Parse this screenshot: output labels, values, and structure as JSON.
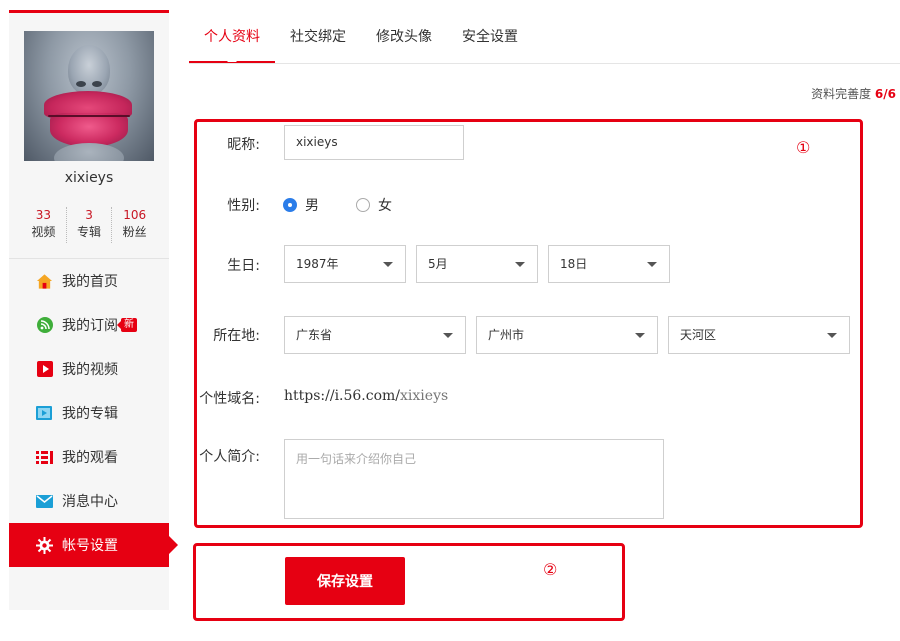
{
  "sidebar": {
    "username": "xixieys",
    "stats": [
      {
        "num": "33",
        "label": "视频"
      },
      {
        "num": "3",
        "label": "专辑"
      },
      {
        "num": "106",
        "label": "粉丝"
      }
    ],
    "nav": [
      {
        "label": "我的首页",
        "icon": "home-icon"
      },
      {
        "label": "我的订阅",
        "icon": "rss-icon",
        "badge": "新"
      },
      {
        "label": "我的视频",
        "icon": "play-icon"
      },
      {
        "label": "我的专辑",
        "icon": "album-icon"
      },
      {
        "label": "我的观看",
        "icon": "history-list-icon"
      },
      {
        "label": "消息中心",
        "icon": "mail-icon"
      },
      {
        "label": "帐号设置",
        "icon": "gear-icon",
        "active": true
      }
    ]
  },
  "tabs": [
    {
      "label": "个人资料",
      "active": true
    },
    {
      "label": "社交绑定"
    },
    {
      "label": "修改头像"
    },
    {
      "label": "安全设置"
    }
  ],
  "completeness": {
    "label": "资料完善度",
    "value": "6/6"
  },
  "annotations": {
    "one": "①",
    "two": "②"
  },
  "form": {
    "nickname": {
      "label": "昵称:",
      "value": "xixieys"
    },
    "gender": {
      "label": "性别:",
      "options": [
        "男",
        "女"
      ],
      "selected": "男"
    },
    "birthday": {
      "label": "生日:",
      "year": "1987年",
      "month": "5月",
      "day": "18日"
    },
    "location": {
      "label": "所在地:",
      "province": "广东省",
      "city": "广州市",
      "district": "天河区"
    },
    "domain": {
      "label": "个性域名:",
      "prefix": "https://i.56.com/",
      "name": "xixieys"
    },
    "bio": {
      "label": "个人简介:",
      "placeholder": "用一句话来介绍你自己"
    },
    "save_label": "保存设置"
  },
  "colors": {
    "accent": "#e60012",
    "radio": "#2b7de9"
  }
}
